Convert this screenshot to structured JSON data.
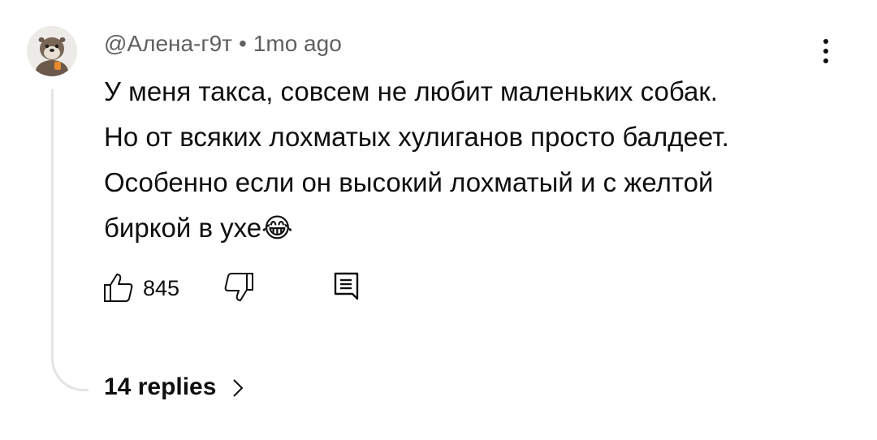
{
  "comment": {
    "author": "@Алена-г9т",
    "separator": "•",
    "time": "1mo ago",
    "lines": [
      "У меня такса, совсем не любит маленьких собак.",
      "Но от всяких лохматых хулиганов просто балдеет.",
      "Особенно если он высокий лохматый и с желтой",
      "биркой в ухе😂"
    ],
    "likes": "845",
    "replies_label": "14 replies"
  },
  "icons": {
    "avatar": "otter-avatar",
    "more": "more-vert-icon",
    "like": "thumb-up-icon",
    "dislike": "thumb-down-icon",
    "reply": "reply-comment-icon",
    "replies_chevron": "chevron-right-icon"
  }
}
